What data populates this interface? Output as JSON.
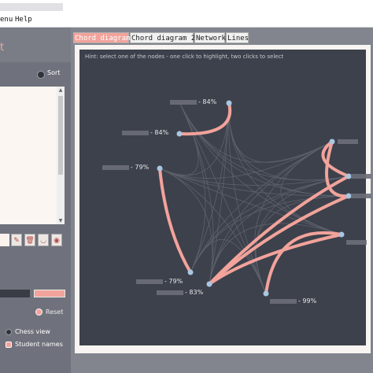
{
  "menu": {
    "items": [
      "enu",
      "Help"
    ]
  },
  "app": {
    "title_fragment": "t"
  },
  "sort": {
    "label": "Sort"
  },
  "reset": {
    "label": "Reset"
  },
  "options": {
    "chess_view": "Chess view",
    "student_names": "Student names"
  },
  "tabs": [
    {
      "label": "Chord diagram",
      "active": true
    },
    {
      "label": "Chord diagram 2",
      "active": false
    },
    {
      "label": "Network",
      "active": false
    },
    {
      "label": "Lines",
      "active": false
    }
  ],
  "hint": "Hint: select one of the nodes - one click to highlight, two clicks to select",
  "nodes": [
    {
      "label": "- 84%"
    },
    {
      "label": "- 84%"
    },
    {
      "label": "- 79%"
    },
    {
      "label": "- 79%"
    },
    {
      "label": "- 83%"
    },
    {
      "label": "- 99%"
    }
  ],
  "colors": {
    "accent": "#f2a39b",
    "canvas": "#3d414c",
    "node": "#a9c6e2"
  }
}
